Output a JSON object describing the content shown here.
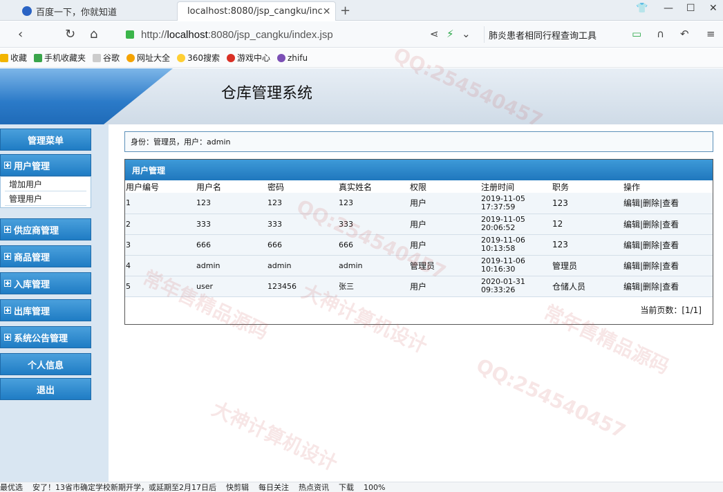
{
  "browser": {
    "tabs": [
      {
        "title": "百度一下，你就知道"
      },
      {
        "title": "localhost:8080/jsp_cangku/inc"
      }
    ],
    "url_prefix": "http://",
    "url_host": "localhost",
    "url_rest": ":8080/jsp_cangku/index.jsp",
    "search_text": "肺炎患者相同行程查询工具",
    "bookmarks": [
      "收藏",
      "手机收藏夹",
      "谷歌",
      "网址大全",
      "360搜索",
      "游戏中心",
      "zhifu"
    ]
  },
  "app": {
    "title": "仓库管理系统"
  },
  "sidebar": {
    "header": "管理菜单",
    "groups": [
      {
        "label": "用户管理"
      },
      {
        "label": "供应商管理"
      },
      {
        "label": "商品管理"
      },
      {
        "label": "入库管理"
      },
      {
        "label": "出库管理"
      },
      {
        "label": "系统公告管理"
      }
    ],
    "submenu": [
      "增加用户",
      "管理用户"
    ],
    "personal": "个人信息",
    "logout": "退出"
  },
  "identity": "身份：管理员，用户：admin",
  "panel": {
    "title": "用户管理",
    "columns": [
      "用户编号",
      "用户名",
      "密码",
      "真实姓名",
      "权限",
      "注册时间",
      "职务",
      "操作"
    ],
    "rows": [
      {
        "id": "1",
        "username": "123",
        "password": "123",
        "realname": "123",
        "role": "用户",
        "date": "2019-11-05",
        "time": "17:37:59",
        "job": "123"
      },
      {
        "id": "2",
        "username": "333",
        "password": "333",
        "realname": "333",
        "role": "用户",
        "date": "2019-11-05",
        "time": "20:06:52",
        "job": "12"
      },
      {
        "id": "3",
        "username": "666",
        "password": "666",
        "realname": "666",
        "role": "用户",
        "date": "2019-11-06",
        "time": "10:13:58",
        "job": "123"
      },
      {
        "id": "4",
        "username": "admin",
        "password": "admin",
        "realname": "admin",
        "role": "管理员",
        "date": "2019-11-06",
        "time": "10:16:30",
        "job": "管理员"
      },
      {
        "id": "5",
        "username": "user",
        "password": "123456",
        "realname": "张三",
        "role": "用户",
        "date": "2020-01-31",
        "time": "09:33:26",
        "job": "仓储人员"
      }
    ],
    "op_edit": "编辑",
    "op_delete": "|删除",
    "op_view": "|查看",
    "pager": "当前页数：[1/1]"
  },
  "statusbar": {
    "left": "最优选",
    "news": "安了！13省市确定学校新期开学，或延期至2月17日后",
    "items": [
      "快剪辑",
      "每日关注",
      "热点资讯",
      "下载",
      "100%"
    ]
  },
  "watermark": {
    "qq": "QQ:254540457",
    "a": "常年售精品源码",
    "b": "大神计算机设计"
  }
}
